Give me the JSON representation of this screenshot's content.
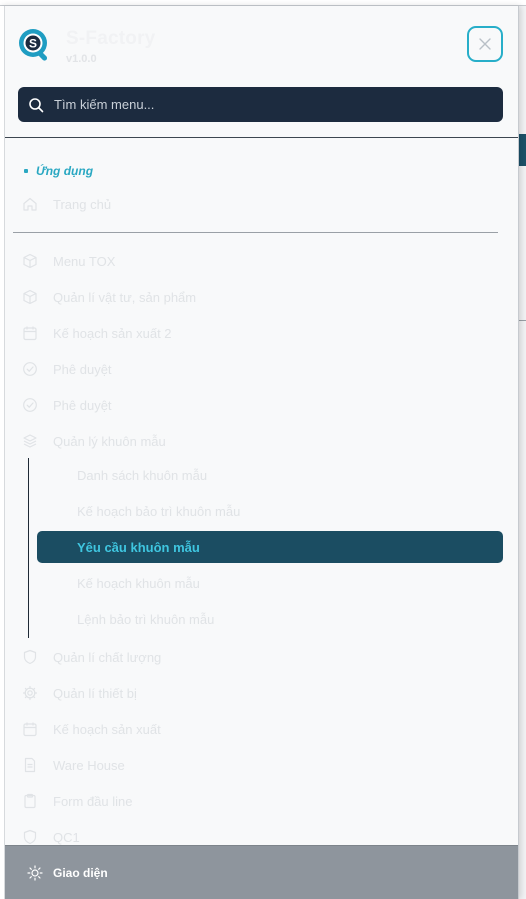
{
  "brand": {
    "name": "S-Factory",
    "version": "v1.0.0"
  },
  "search": {
    "placeholder": "Tìm kiếm menu..."
  },
  "section": {
    "title": "Ứng dụng"
  },
  "menu": {
    "home": "Trang chủ",
    "items": [
      {
        "label": "Menu TOX",
        "icon": "cube-icon"
      },
      {
        "label": "Quản lí vật tư, sản phẩm",
        "icon": "cube-icon"
      },
      {
        "label": "Kế hoạch sản xuất 2",
        "icon": "calendar-icon"
      },
      {
        "label": "Phê duyệt",
        "icon": "check-circle-icon"
      },
      {
        "label": "Phê duyệt",
        "icon": "check-circle-icon"
      },
      {
        "label": "Quản lý khuôn mẫu",
        "icon": "layers-icon"
      }
    ],
    "submenu": [
      "Danh sách khuôn mẫu",
      "Kế hoạch bảo trì khuôn mẫu",
      "Yêu cầu khuôn mẫu",
      "Kế hoạch khuôn mẫu",
      "Lệnh bảo trì khuôn mẫu"
    ],
    "items_after": [
      {
        "label": "Quản lí chất lượng",
        "icon": "shield-icon"
      },
      {
        "label": "Quản lí thiết bị",
        "icon": "gear-icon"
      },
      {
        "label": "Kế hoạch sản xuất",
        "icon": "calendar-icon"
      },
      {
        "label": "Ware House",
        "icon": "document-icon"
      },
      {
        "label": "Form đầu line",
        "icon": "clipboard-icon"
      },
      {
        "label": "QC1",
        "icon": "shield-icon"
      }
    ]
  },
  "footer": {
    "label": "Giao diện",
    "icon": "sun-icon"
  },
  "colors": {
    "accent": "#2aa8c2",
    "active_bg": "#1b4d62",
    "search_bg": "#1c2b3f",
    "footer_bg": "#8e959d"
  }
}
